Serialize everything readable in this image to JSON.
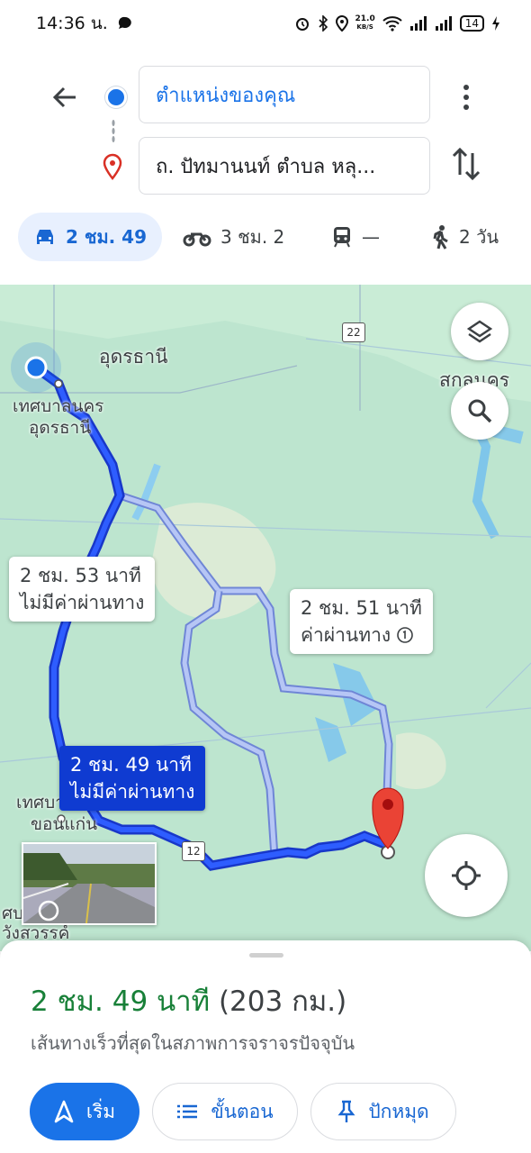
{
  "status_bar": {
    "time": "14:36 น.",
    "net_speed": "21.0",
    "net_unit": "KB/S",
    "battery": "14"
  },
  "search": {
    "origin": "ตำแหน่งของคุณ",
    "destination": "ถ. ปัทมานนท์ ตำบล หลุ..."
  },
  "modes": [
    {
      "icon": "car-icon",
      "label": "2 ชม. 49",
      "active": true
    },
    {
      "icon": "motorcycle-icon",
      "label": "3 ชม. 2"
    },
    {
      "icon": "train-icon",
      "label": "—"
    },
    {
      "icon": "walk-icon",
      "label": "2 วัน"
    }
  ],
  "map": {
    "place_labels": {
      "udon": "อุดรธานี",
      "sakon": "สกลนคร",
      "udon_city_1": "เทศบาลนคร",
      "udon_city_2": "อุดรธานี",
      "khonkaen_1": "เทศบา",
      "khonkaen_2": "ขอนแก่น",
      "wang_1": "ศบ",
      "wang_2": "วังสวรรค์"
    },
    "road_shields": {
      "r22": "22",
      "r12": "12"
    },
    "routes": [
      {
        "time": "2 ชม. 53 นาที",
        "note": "ไม่มีค่าผ่านทาง"
      },
      {
        "time": "2 ชม. 51 นาที",
        "note": "ค่าผ่านทาง"
      },
      {
        "time": "2 ชม. 49 นาที",
        "note": "ไม่มีค่าผ่านทาง",
        "selected": true
      }
    ]
  },
  "sheet": {
    "duration": "2 ชม. 49 นาที",
    "distance": "(203 กม.)",
    "description": "เส้นทางเร็วที่สุดในสภาพการจราจรปัจจุบัน",
    "buttons": {
      "start": "เริ่ม",
      "steps": "ขั้นตอน",
      "pin": "ปักหมุด"
    }
  },
  "colors": {
    "accent": "#1a73e8",
    "route_selected": "#1f3bd6",
    "route_alt": "#9fb4f2",
    "time_green": "#188038",
    "pin_red": "#ea4335"
  }
}
